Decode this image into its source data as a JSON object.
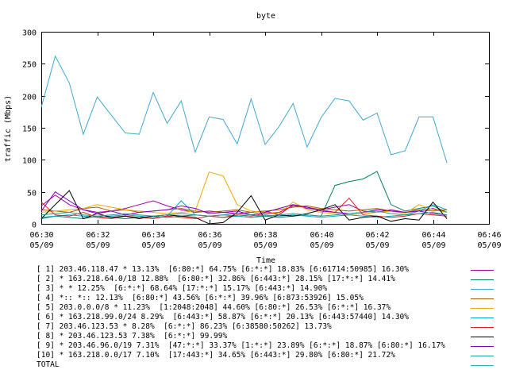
{
  "chart_data": {
    "type": "line",
    "title": "byte",
    "xlabel": "Time",
    "ylabel": "traffic (Mbps)",
    "ylim": [
      0,
      300
    ],
    "yticks": [
      0,
      50,
      100,
      150,
      200,
      250,
      300
    ],
    "xlim": [
      0,
      16
    ],
    "xticks": [
      {
        "at": 0,
        "time": "06:30",
        "date": "05/09"
      },
      {
        "at": 2,
        "time": "06:32",
        "date": "05/09"
      },
      {
        "at": 4,
        "time": "06:34",
        "date": "05/09"
      },
      {
        "at": 6,
        "time": "06:36",
        "date": "05/09"
      },
      {
        "at": 8,
        "time": "06:38",
        "date": "05/09"
      },
      {
        "at": 10,
        "time": "06:40",
        "date": "05/09"
      },
      {
        "at": 12,
        "time": "06:42",
        "date": "05/09"
      },
      {
        "at": 14,
        "time": "06:44",
        "date": "05/09"
      },
      {
        "at": 16,
        "time": "06:46",
        "date": "05/09"
      }
    ],
    "x": [
      0,
      0.5,
      1,
      1.5,
      2,
      2.5,
      3,
      3.5,
      4,
      4.5,
      5,
      5.5,
      6,
      6.5,
      7,
      7.5,
      8,
      8.5,
      9,
      9.5,
      10,
      10.5,
      11,
      11.5,
      12,
      12.5,
      13,
      13.5,
      14,
      14.5
    ],
    "series": [
      {
        "label": "[ 1] 203.46.118.47 * 13.13%  [6:80:*] 64.75% [6:*:*] 18.83% [6:61714:50985] 16.30%",
        "color": "#a000a0",
        "values": [
          28,
          45,
          30,
          22,
          18,
          20,
          24,
          30,
          36,
          28,
          22,
          18,
          20,
          18,
          16,
          18,
          20,
          14,
          30,
          24,
          22,
          26,
          30,
          20,
          18,
          22,
          18,
          20,
          24,
          18
        ]
      },
      {
        "label": "[ 2] * 163.218.64.0/18 12.88%  [6:80:*] 32.86% [6:443:*] 28.15% [17:*:*] 14.41%",
        "color": "#008060",
        "values": [
          8,
          12,
          10,
          8,
          12,
          10,
          8,
          10,
          12,
          10,
          12,
          14,
          12,
          10,
          12,
          10,
          12,
          10,
          12,
          14,
          12,
          60,
          66,
          70,
          82,
          30,
          20,
          24,
          28,
          18
        ]
      },
      {
        "label": "[ 3] * * 12.25%  [6:*:*] 68.64% [17:*:*] 15.17% [6:443:*] 14.90%",
        "color": "#40a8d0",
        "values": [
          182,
          262,
          220,
          140,
          198,
          170,
          142,
          140,
          205,
          157,
          192,
          112,
          167,
          163,
          125,
          195,
          124,
          152,
          188,
          120,
          166,
          196,
          192,
          162,
          173,
          108,
          114,
          167,
          167,
          95
        ]
      },
      {
        "label": "[ 4] *:: *:: 12.13%  [6:80:*] 43.56% [6:*:*] 39.96% [6:873:53926] 15.05%",
        "color": "#a06000",
        "values": [
          22,
          20,
          18,
          24,
          26,
          20,
          22,
          18,
          20,
          22,
          24,
          20,
          18,
          20,
          22,
          18,
          20,
          22,
          26,
          28,
          24,
          22,
          20,
          22,
          24,
          20,
          18,
          22,
          20,
          22
        ]
      },
      {
        "label": "[ 5] 203.0.0.0/8 * 11.23%  [1:2048:2048] 44.60% [6:80:*] 26.53% [6:*:*] 16.37%",
        "color": "#f0a800",
        "values": [
          18,
          20,
          22,
          24,
          30,
          26,
          22,
          20,
          18,
          16,
          18,
          20,
          81,
          75,
          30,
          20,
          18,
          16,
          34,
          22,
          18,
          16,
          14,
          16,
          18,
          20,
          16,
          30,
          22,
          18
        ]
      },
      {
        "label": "[ 6] * 163.218.99.0/24 8.29%  [6:443:*] 58.87% [6:*:*] 20.13% [6:443:57440] 14.30%",
        "color": "#00a8c8",
        "values": [
          10,
          12,
          14,
          12,
          10,
          12,
          14,
          12,
          10,
          12,
          36,
          14,
          12,
          14,
          12,
          10,
          14,
          12,
          14,
          12,
          10,
          12,
          14,
          12,
          10,
          12,
          14,
          20,
          30,
          22
        ]
      },
      {
        "label": "[ 7] 203.46.123.53 * 8.28%  [6:*:*] 86.23% [6:38580:50262] 13.73%",
        "color": "#e02020",
        "values": [
          34,
          14,
          12,
          18,
          10,
          8,
          12,
          10,
          8,
          12,
          10,
          8,
          12,
          10,
          14,
          12,
          16,
          18,
          28,
          26,
          22,
          18,
          40,
          14,
          12,
          10,
          12,
          16,
          14,
          12
        ]
      },
      {
        "label": "[ 8] * 203.46.123.53 7.38%  [6:*:*] 99.99%",
        "color": "#000000",
        "values": [
          8,
          30,
          52,
          8,
          16,
          10,
          12,
          8,
          12,
          14,
          12,
          10,
          0,
          2,
          18,
          44,
          6,
          14,
          12,
          16,
          22,
          30,
          6,
          10,
          12,
          4,
          8,
          6,
          34,
          8
        ]
      },
      {
        "label": "[ 9] * 203.46.96.0/19 7.31%  [47:*:*] 33.37% [1:*:*] 23.89% [6:*:*] 18.87% [6:80:*] 16.17%",
        "color": "#8000c0",
        "values": [
          20,
          50,
          36,
          22,
          16,
          20,
          14,
          18,
          20,
          22,
          28,
          24,
          16,
          18,
          20,
          14,
          18,
          24,
          30,
          26,
          20,
          18,
          16,
          18,
          22,
          20,
          18,
          20,
          16,
          14
        ]
      },
      {
        "label": "[10] * 163.218.0.0/17 7.10%  [17:443:*] 34.65% [6:443:*] 29.80% [6:80:*] 21.72%",
        "color": "#20a090",
        "values": [
          14,
          16,
          18,
          14,
          12,
          14,
          16,
          14,
          12,
          14,
          16,
          14,
          12,
          14,
          16,
          14,
          12,
          14,
          16,
          14,
          12,
          14,
          16,
          18,
          20,
          16,
          14,
          16,
          18,
          14
        ]
      },
      {
        "label": "TOTAL",
        "color": "#30b0b0",
        "values": []
      }
    ]
  }
}
